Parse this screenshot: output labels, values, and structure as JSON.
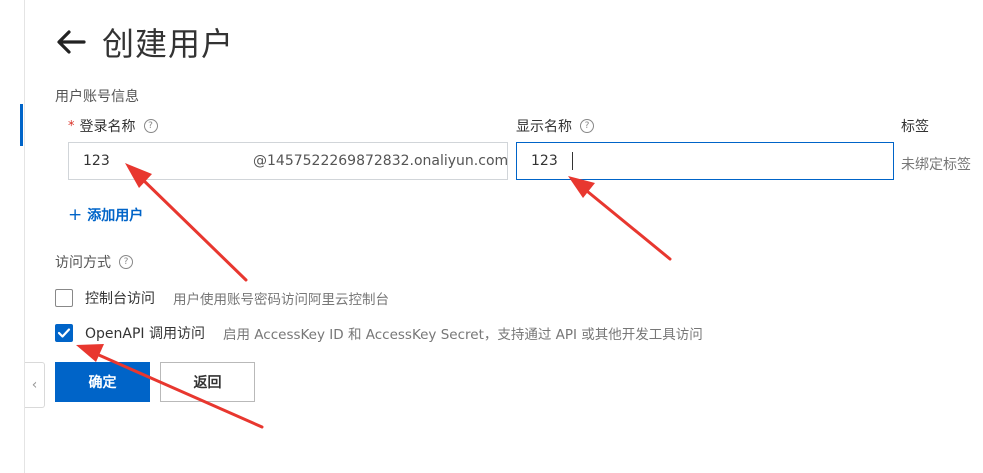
{
  "header": {
    "title": "创建用户"
  },
  "form": {
    "section_title": "用户账号信息",
    "required_mark": "*",
    "login_name_label": "登录名称",
    "login_name_value": "123",
    "login_name_suffix": "@1457522269872832.onaliyun.com",
    "display_name_label": "显示名称",
    "display_name_value": "123",
    "tag_label": "标签",
    "tag_value": "未绑定标签",
    "add_user": "添加用户"
  },
  "access": {
    "label": "访问方式",
    "options": [
      {
        "name": "控制台访问",
        "description": "用户使用账号密码访问阿里云控制台",
        "checked": false
      },
      {
        "name": "OpenAPI 调用访问",
        "description": "启用 AccessKey ID 和 AccessKey Secret，支持通过 API 或其他开发工具访问",
        "checked": true
      }
    ]
  },
  "actions": {
    "confirm": "确定",
    "back": "返回"
  },
  "colors": {
    "primary": "#0064c8",
    "annotation_arrow": "#e8372f",
    "required": "#d93026"
  },
  "icons": [
    "back-arrow-icon",
    "help-icon",
    "plus-icon",
    "checkmark-icon",
    "chevron-left-icon"
  ]
}
